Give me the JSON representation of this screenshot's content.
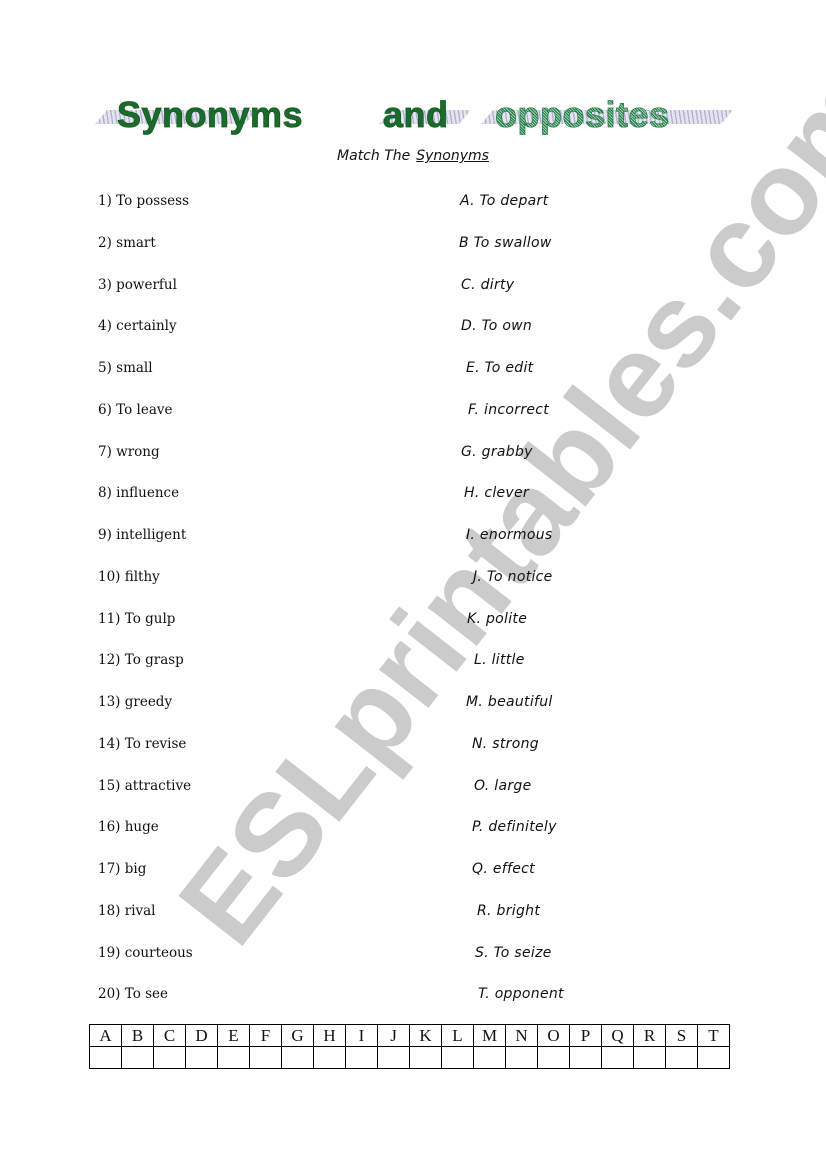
{
  "title": {
    "word1": "Synonyms",
    "word2": "and",
    "word3": "opposites",
    "colors": {
      "solid_green": "#1d6b2c",
      "dither_green": "#2e8a55",
      "shadow": "#a9a9c9"
    }
  },
  "subtitle": {
    "prefix": "Match The",
    "emphasis": "Synonyms"
  },
  "watermark": "ESLprintables.com",
  "left_items": [
    "1) To possess",
    "2) smart",
    "3) powerful",
    "4) certainly",
    "5) small",
    "6) To leave",
    "7) wrong",
    "8) influence",
    "9) intelligent",
    "10) filthy",
    "11) To gulp",
    "12) To grasp",
    "13) greedy",
    "14) To revise",
    "15) attractive",
    "16) huge",
    "17) big",
    "18) rival",
    "19) courteous",
    "20) To see"
  ],
  "right_items": [
    "A. To depart",
    "B To swallow",
    "C. dirty",
    "D. To own",
    "E. To edit",
    "F. incorrect",
    "G. grabby",
    "H. clever",
    "I. enormous",
    "J. To notice",
    "K. polite",
    "L. little",
    "M. beautiful",
    "N. strong",
    "O. large",
    "P. definitely",
    "Q. effect",
    "R. bright",
    "S. To seize",
    "T. opponent"
  ],
  "answer_table": {
    "headers": [
      "A",
      "B",
      "C",
      "D",
      "E",
      "F",
      "G",
      "H",
      "I",
      "J",
      "K",
      "L",
      "M",
      "N",
      "O",
      "P",
      "Q",
      "R",
      "S",
      "T"
    ],
    "answers": [
      "",
      "",
      "",
      "",
      "",
      "",
      "",
      "",
      "",
      "",
      "",
      "",
      "",
      "",
      "",
      "",
      "",
      "",
      "",
      ""
    ]
  }
}
